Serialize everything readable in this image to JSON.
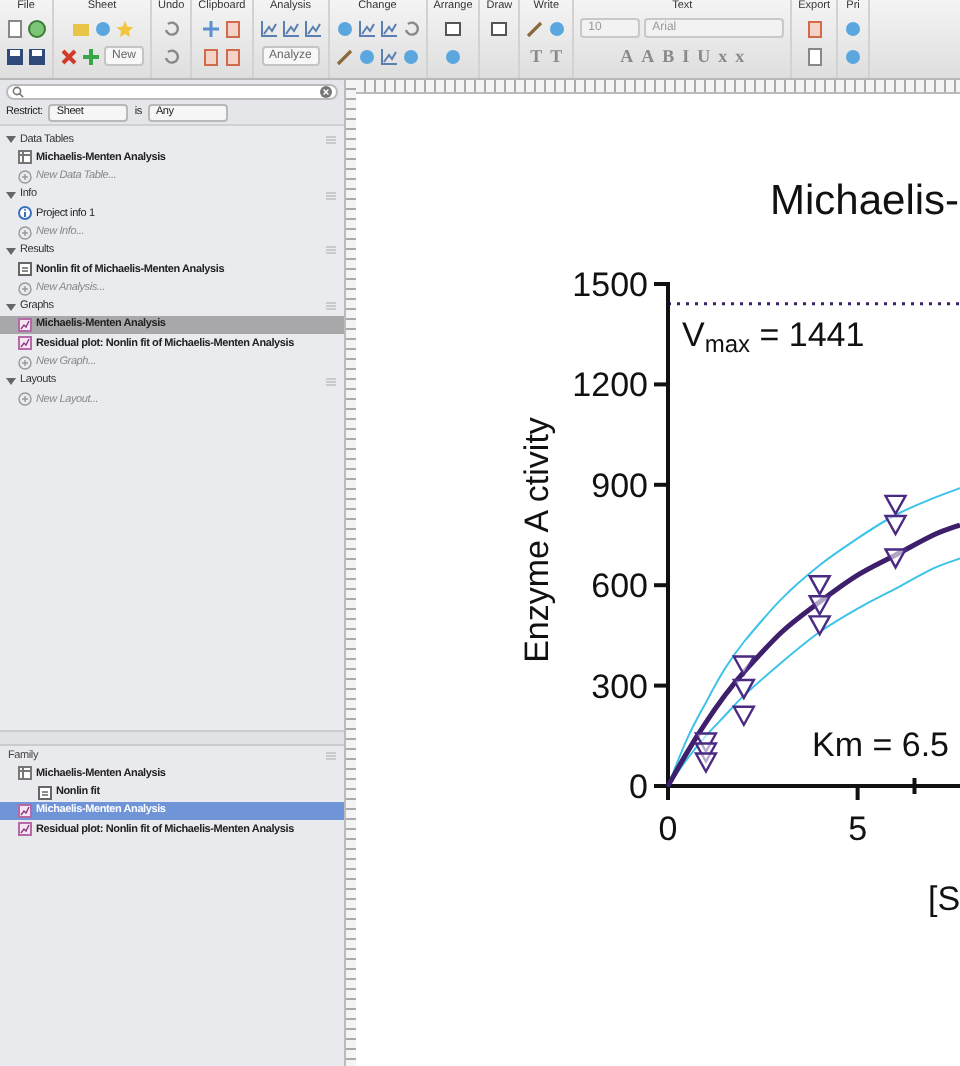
{
  "toolbar": {
    "groups": [
      {
        "kind": "file",
        "label": "File"
      },
      {
        "kind": "sheet",
        "label": "Sheet",
        "buttons": [
          "New"
        ]
      },
      {
        "kind": "undo",
        "label": "Undo"
      },
      {
        "kind": "clipboard",
        "label": "Clipboard"
      },
      {
        "kind": "analysis",
        "label": "Analysis",
        "buttons": [
          "Analyze"
        ]
      },
      {
        "kind": "change",
        "label": "Change"
      },
      {
        "kind": "arrange",
        "label": "Arrange"
      },
      {
        "kind": "draw",
        "label": "Draw"
      },
      {
        "kind": "write",
        "label": "Write",
        "glyphs": [
          "T",
          "T"
        ]
      },
      {
        "kind": "text",
        "label": "Text",
        "fields": [
          "10",
          "Arial"
        ],
        "glyphs": [
          "A",
          "A",
          "B",
          "I",
          "U",
          "x",
          "x"
        ]
      },
      {
        "kind": "export",
        "label": "Export"
      },
      {
        "kind": "print",
        "label": "Pri"
      }
    ]
  },
  "navigator": {
    "restrict": {
      "label": "Restrict:",
      "value": "Sheet",
      "connector": "is",
      "value_2": "Any"
    },
    "sections": [
      {
        "title": "Data Tables",
        "expanded": true,
        "items": [
          {
            "kind": "table",
            "label": "Michaelis-Menten Analysis",
            "selected": false
          },
          {
            "kind": "new",
            "label": "New Data Table...",
            "selected": false
          }
        ]
      },
      {
        "title": "Info",
        "expanded": true,
        "items": [
          {
            "kind": "info",
            "label": "Project info 1",
            "selected": false
          },
          {
            "kind": "new",
            "label": "New Info...",
            "selected": false
          }
        ]
      },
      {
        "title": "Results",
        "expanded": true,
        "items": [
          {
            "kind": "results",
            "label": "Nonlin fit of Michaelis-Menten Analysis",
            "selected": false
          },
          {
            "kind": "new",
            "label": "New Analysis...",
            "selected": false
          }
        ]
      },
      {
        "title": "Graphs",
        "expanded": true,
        "items": [
          {
            "kind": "graph",
            "label": "Michaelis-Menten Analysis",
            "selected": true
          },
          {
            "kind": "graph",
            "label": "Residual plot: Nonlin fit of Michaelis-Menten Analysis",
            "selected": false
          },
          {
            "kind": "new",
            "label": "New Graph...",
            "selected": false
          }
        ]
      },
      {
        "title": "Layouts",
        "expanded": true,
        "items": [
          {
            "kind": "new",
            "label": "New Layout...",
            "selected": false
          }
        ]
      }
    ]
  },
  "family": {
    "title": "Family",
    "items": [
      {
        "kind": "table",
        "label": "Michaelis-Menten Analysis",
        "selected": false,
        "children": [
          {
            "kind": "results",
            "label": "Nonlin fit",
            "selected": false
          }
        ]
      },
      {
        "kind": "graph",
        "label": "Michaelis-Menten Analysis",
        "selected": true
      },
      {
        "kind": "graph",
        "label": "Residual plot: Nonlin fit of Michaelis-Menten Analysis",
        "selected": false
      }
    ]
  },
  "graph": {
    "chart_data": {
      "type": "scatter",
      "title": "Michaelis-",
      "xlabel": "[S",
      "ylabel": "Enzyme A ctivity",
      "x": [
        1,
        1,
        1,
        2,
        2,
        2,
        4,
        4,
        4,
        6,
        6,
        6
      ],
      "series": [
        {
          "type": "scatter",
          "color": "#4b2a84",
          "values": [
            130,
            100,
            70,
            360,
            290,
            210,
            600,
            540,
            480,
            840,
            780,
            680
          ]
        },
        {
          "type": "line",
          "color": "#3cc3ea",
          "x": [
            0,
            0.5,
            1,
            1.5,
            2,
            3,
            4,
            5,
            6,
            7,
            7.7
          ],
          "values": [
            0,
            140,
            250,
            350,
            430,
            560,
            660,
            740,
            810,
            860,
            890
          ]
        },
        {
          "type": "line",
          "color": "#3cc3ea",
          "x": [
            0,
            0.5,
            1,
            1.5,
            2,
            3,
            4,
            5,
            6,
            7,
            7.7
          ],
          "values": [
            0,
            80,
            150,
            210,
            270,
            370,
            460,
            530,
            590,
            650,
            680
          ]
        },
        {
          "type": "line",
          "color": "#3d1f6b",
          "x": [
            0,
            0.5,
            1,
            1.5,
            2,
            3,
            4,
            5,
            6,
            7,
            7.7
          ],
          "values": [
            0,
            100,
            190,
            270,
            340,
            460,
            550,
            630,
            690,
            750,
            780
          ]
        }
      ],
      "ref_lines": [
        {
          "axis": "y",
          "value": 1441,
          "color": "#3d1f6b"
        }
      ],
      "xlim": [
        0,
        7.7
      ],
      "ylim": [
        0,
        1500
      ],
      "xticks": [
        0,
        5
      ],
      "yticks": [
        0,
        300,
        600,
        900,
        1200,
        1500
      ],
      "annotations": [
        "V$_{max}$ = 1441",
        "Km = 6.5"
      ]
    }
  }
}
